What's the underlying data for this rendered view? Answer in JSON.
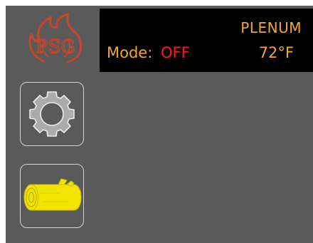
{
  "brand": {
    "logo_text": "PSG",
    "logo_icon": "flame-logo-icon",
    "colors": {
      "flame": "#c8462b",
      "flame_dark": "#8c2a18"
    }
  },
  "status": {
    "mode_label": "Mode:",
    "mode_value": "OFF",
    "sensor_label": "PLENUM",
    "temperature": "72°F",
    "colors": {
      "label": "#f4a72e",
      "off": "#ff1a1a",
      "panel_bg": "#000000"
    }
  },
  "buttons": {
    "settings": {
      "icon": "gear-icon"
    },
    "fuel": {
      "icon": "log-icon",
      "color": "#f2e400"
    }
  },
  "theme": {
    "background": "#5a5a5a",
    "button_border": "#d4d4d4"
  }
}
